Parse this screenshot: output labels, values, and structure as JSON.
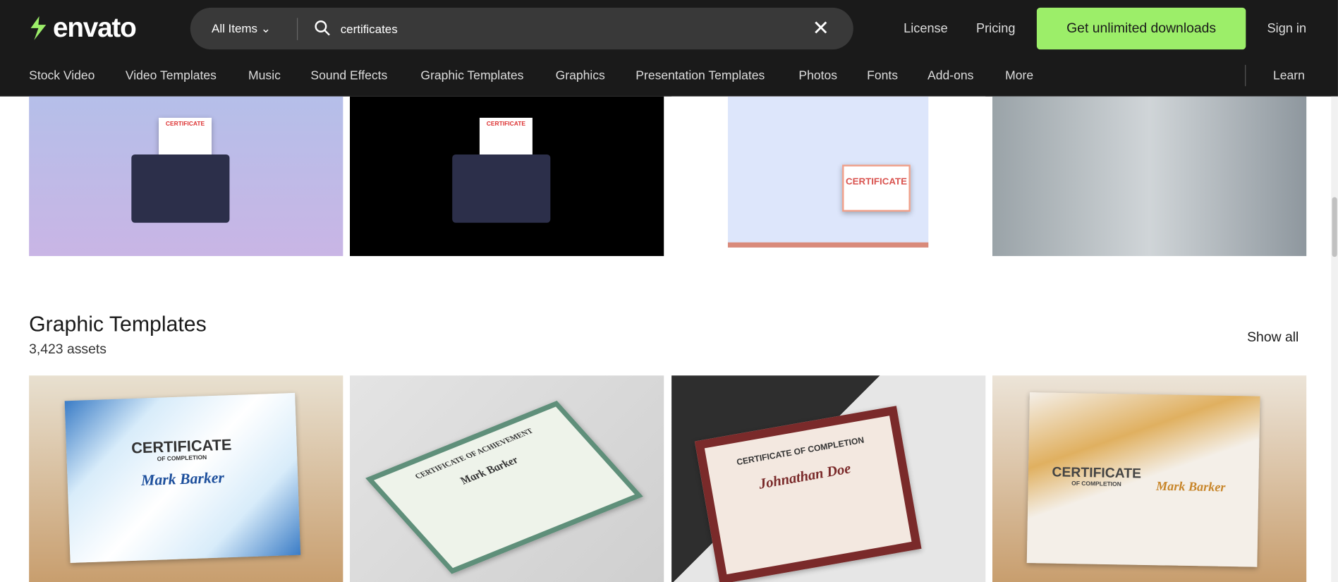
{
  "header": {
    "logo": "envato",
    "search": {
      "category": "All Items",
      "query": "certificates"
    },
    "links": [
      "License",
      "Pricing"
    ],
    "cta": "Get unlimited downloads",
    "sign_in": "Sign in"
  },
  "nav": {
    "items": [
      "Stock Video",
      "Video Templates",
      "Music",
      "Sound Effects",
      "Graphic Templates",
      "Graphics",
      "Presentation Templates",
      "Photos",
      "Fonts",
      "Add-ons",
      "More"
    ],
    "learn": "Learn"
  },
  "top_row": {
    "cert_labels": [
      "CERTIFICATE",
      "CERTIFICATE",
      "CERTIFICATE"
    ]
  },
  "section": {
    "title": "Graphic Templates",
    "count": "3,423 assets",
    "show_all": "Show all",
    "items": [
      {
        "title": "CERTIFICATE",
        "sub": "OF COMPLETION",
        "name": "Mark Barker"
      },
      {
        "title": "CERTIFICATE OF ACHIEVEMENT",
        "sub": "",
        "name": "Mark Barker"
      },
      {
        "title": "CERTIFICATE OF COMPLETION",
        "sub": "",
        "name": "Johnathan Doe"
      },
      {
        "title": "CERTIFICATE",
        "sub": "OF COMPLETION",
        "name": "Mark Barker"
      }
    ]
  },
  "colors": {
    "header_bg": "#1a1a1a",
    "accent": "#9cee69"
  }
}
